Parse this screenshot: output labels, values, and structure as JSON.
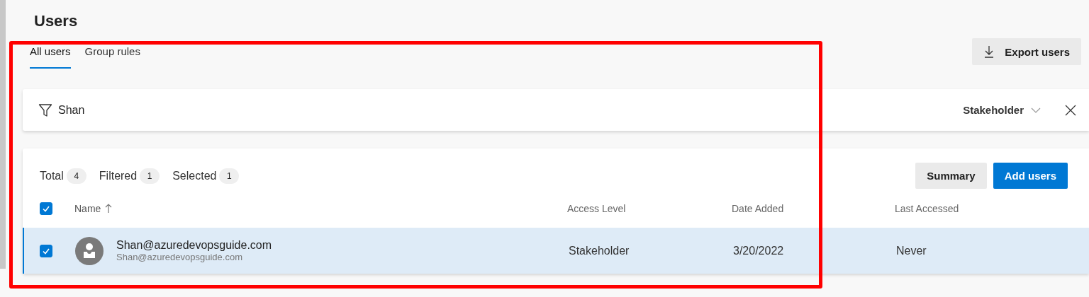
{
  "page_title": "Users",
  "tabs": [
    {
      "label": "All users",
      "selected": true
    },
    {
      "label": "Group rules",
      "selected": false
    }
  ],
  "export_button": "Export users",
  "filter": {
    "value": "Shan",
    "access_dropdown": "Stakeholder"
  },
  "counts": [
    {
      "label": "Total",
      "count": "4"
    },
    {
      "label": "Filtered",
      "count": "1"
    },
    {
      "label": "Selected",
      "count": "1"
    }
  ],
  "buttons": [
    {
      "label": "Summary",
      "kind": "secondary"
    },
    {
      "label": "Add users",
      "kind": "primary"
    }
  ],
  "table": {
    "select_all_checked": true,
    "columns": [
      {
        "label": "Name",
        "sorted": true
      },
      {
        "label": "Access Level",
        "sorted": false
      },
      {
        "label": "Date Added",
        "sorted": false
      },
      {
        "label": "Last Accessed",
        "sorted": false
      }
    ],
    "rows": [
      {
        "selected": true,
        "name": "Shan@azuredevopsguide.com",
        "email": "Shan@azuredevopsguide.com",
        "access_level": "Stakeholder",
        "date_added": "3/20/2022",
        "last_accessed": "Never"
      }
    ]
  }
}
